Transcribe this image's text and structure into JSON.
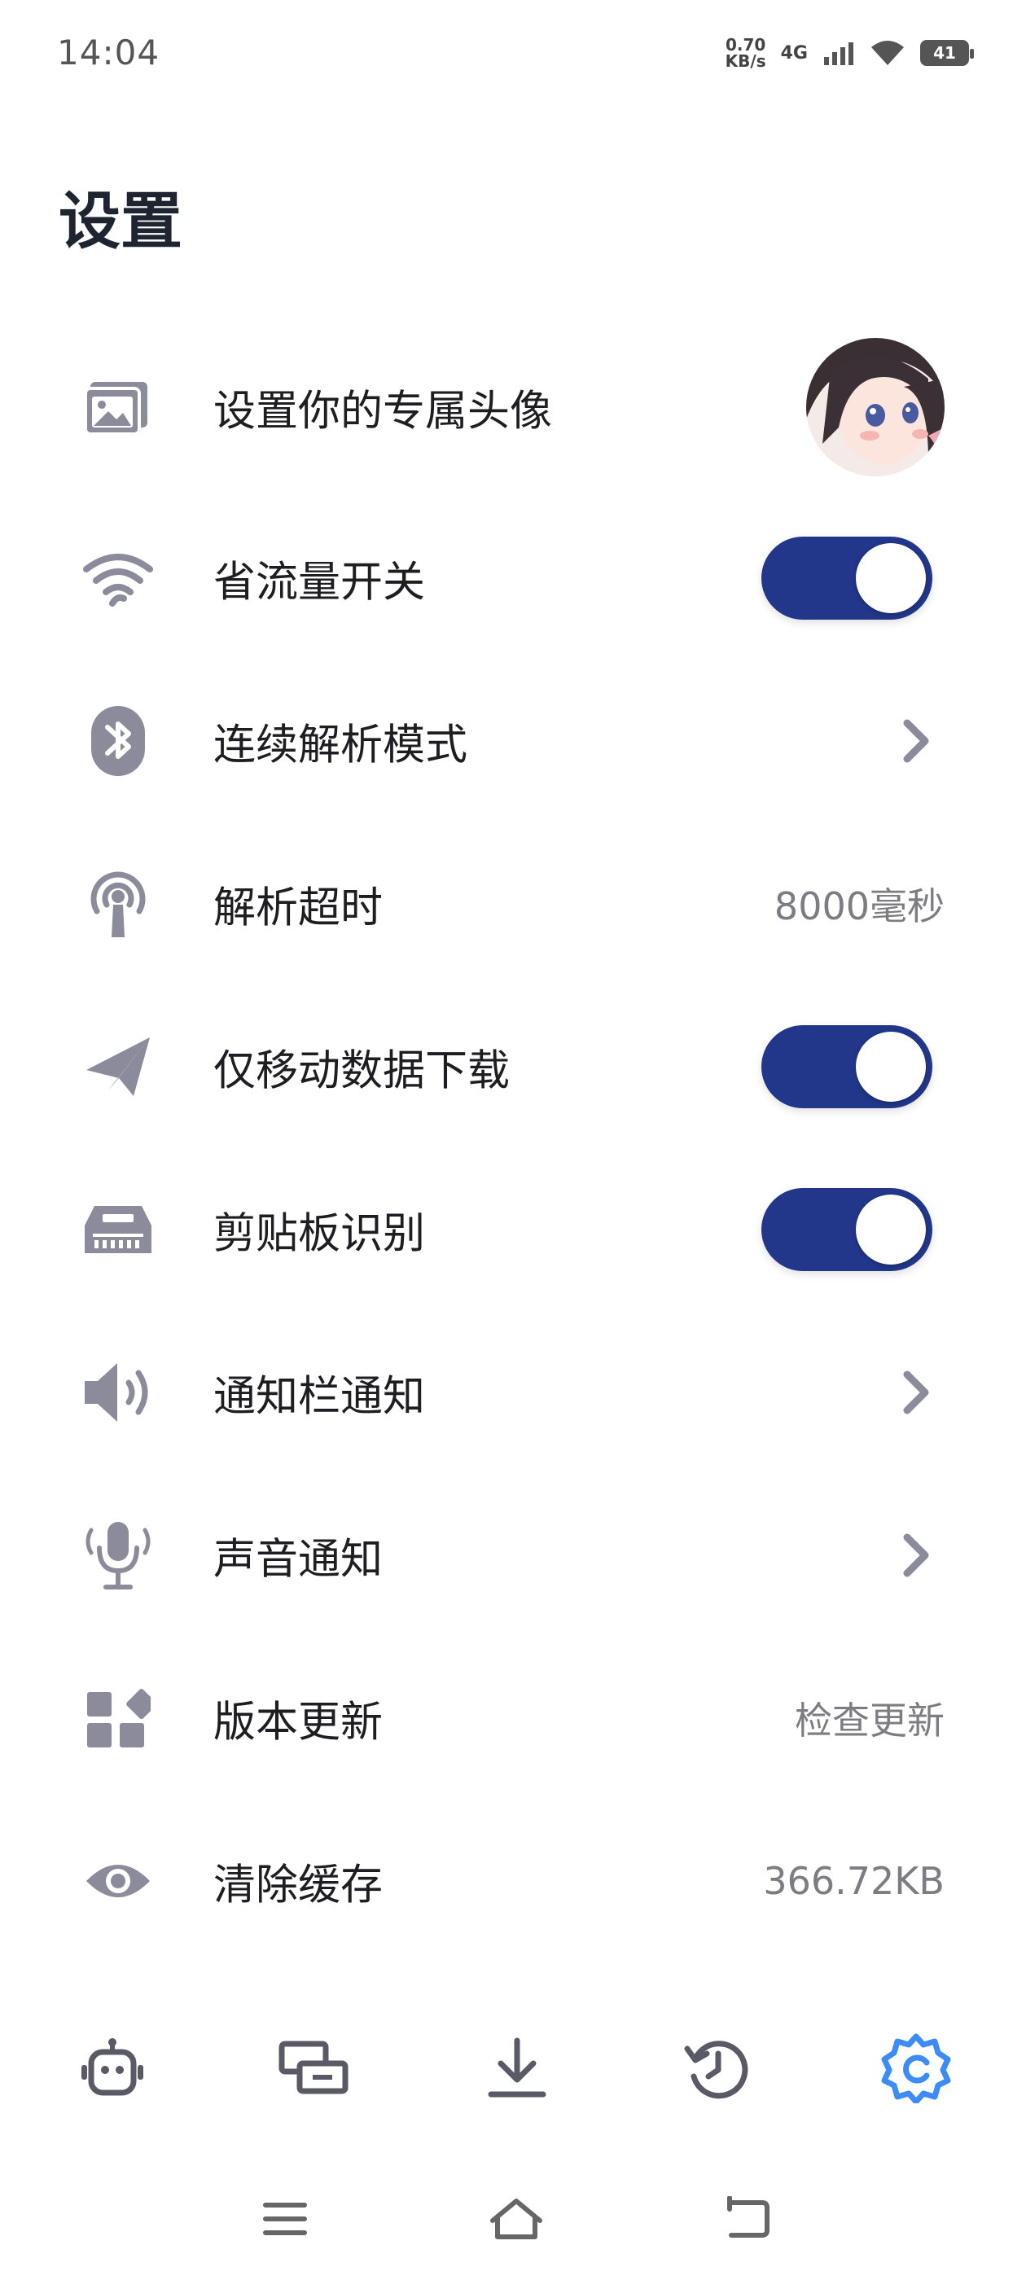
{
  "status_bar": {
    "time": "14:04",
    "speed_value": "0.70",
    "speed_unit": "KB/s",
    "network": "4G",
    "battery": "41"
  },
  "page": {
    "title": "设置"
  },
  "settings": {
    "items": [
      {
        "label": "设置你的专属头像",
        "icon": "image-icon",
        "control": "avatar"
      },
      {
        "label": "省流量开关",
        "icon": "wifi-icon",
        "control": "toggle",
        "state": "on"
      },
      {
        "label": "连续解析模式",
        "icon": "bluetooth-icon",
        "control": "chevron"
      },
      {
        "label": "解析超时",
        "icon": "antenna-icon",
        "control": "value",
        "value": "8000毫秒"
      },
      {
        "label": "仅移动数据下载",
        "icon": "paper-plane-icon",
        "control": "toggle",
        "state": "on"
      },
      {
        "label": "剪贴板识别",
        "icon": "memory-icon",
        "control": "toggle",
        "state": "on"
      },
      {
        "label": "通知栏通知",
        "icon": "speaker-icon",
        "control": "chevron"
      },
      {
        "label": "声音通知",
        "icon": "microphone-icon",
        "control": "chevron"
      },
      {
        "label": "版本更新",
        "icon": "apps-icon",
        "control": "value",
        "value": "检查更新"
      },
      {
        "label": "清除缓存",
        "icon": "eye-icon",
        "control": "value",
        "value": "366.72KB"
      }
    ]
  },
  "bottom_nav": {
    "items": [
      {
        "icon": "robot-icon",
        "active": false
      },
      {
        "icon": "cards-icon",
        "active": false
      },
      {
        "icon": "download-icon",
        "active": false
      },
      {
        "icon": "history-icon",
        "active": false
      },
      {
        "icon": "settings-icon",
        "active": true
      }
    ]
  },
  "system_nav": {
    "items": [
      {
        "icon": "menu-icon"
      },
      {
        "icon": "home-icon"
      },
      {
        "icon": "back-icon"
      }
    ]
  },
  "colors": {
    "accent": "#22378a",
    "icon_gray": "#8b8b9b",
    "active_tab": "#3d8bf5",
    "value_text": "#7c7c82"
  }
}
